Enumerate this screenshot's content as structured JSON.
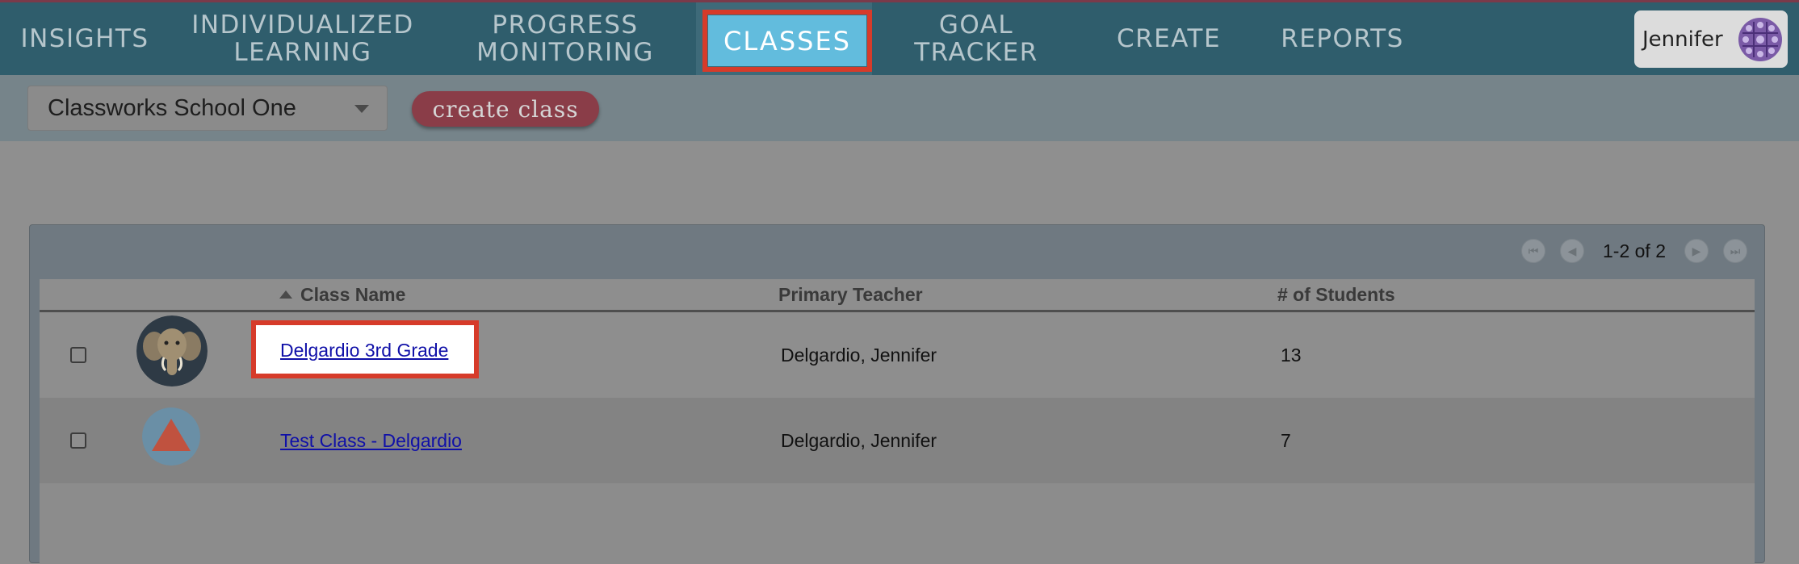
{
  "nav": {
    "items": [
      {
        "label": "INSIGHTS"
      },
      {
        "label": "INDIVIDUALIZED\nLEARNING"
      },
      {
        "label": "PROGRESS\nMONITORING"
      },
      {
        "label": "CLASSES"
      },
      {
        "label": "GOAL TRACKER"
      },
      {
        "label": "CREATE"
      },
      {
        "label": "REPORTS"
      }
    ],
    "active": "CLASSES",
    "user_name": "Jennifer"
  },
  "toolbar": {
    "school_select_value": "Classworks School One",
    "create_class_label": "create class"
  },
  "pager": {
    "text": "1-2 of 2"
  },
  "table": {
    "columns": [
      "Class Name",
      "Primary Teacher",
      "# of Students"
    ],
    "sorted_column": "Class Name",
    "sort_direction": "ascending",
    "rows": [
      {
        "class_name": "Delgardio 3rd Grade",
        "teacher": "Delgardio, Jennifer",
        "students": "13",
        "avatar": "elephant-icon",
        "checked": false
      },
      {
        "class_name": "Test Class - Delgardio",
        "teacher": "Delgardio, Jennifer",
        "students": "7",
        "avatar": "triangle-icon",
        "checked": false
      }
    ]
  },
  "colors": {
    "nav_bg": "#2f5d6c",
    "active_tab": "#62bcdd",
    "highlight": "#d63b2a",
    "create_btn": "#8a3d48",
    "link": "#1010a8"
  }
}
